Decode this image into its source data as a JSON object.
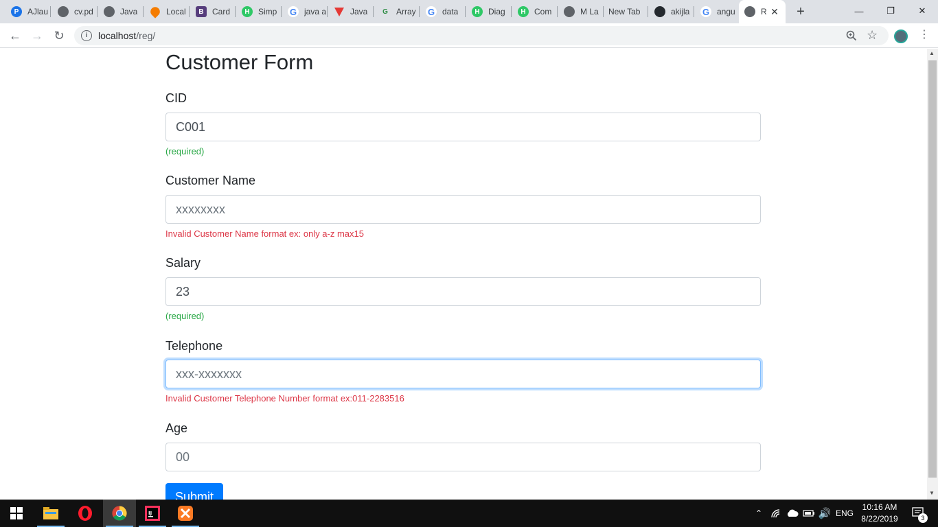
{
  "browser": {
    "tabs": [
      {
        "title": "AJlau",
        "icon": "chat-bubble-icon",
        "color": "#1a73e8"
      },
      {
        "title": "cv.pd",
        "icon": "globe-icon",
        "color": "#5f6368"
      },
      {
        "title": "Java",
        "icon": "globe-icon",
        "color": "#5f6368"
      },
      {
        "title": "Local",
        "icon": "map-pin-icon",
        "color": "#f57c00"
      },
      {
        "title": "Card",
        "icon": "bootstrap-icon",
        "color": "#563d7c"
      },
      {
        "title": "Simp",
        "icon": "hackerrank-icon",
        "color": "#2ec866"
      },
      {
        "title": "java a",
        "icon": "google-icon",
        "color": "#4285f4"
      },
      {
        "title": "Java",
        "icon": "vue-like-icon",
        "color": "#e53935"
      },
      {
        "title": "Array",
        "icon": "geeksforgeeks-icon",
        "color": "#2f8d46"
      },
      {
        "title": "data",
        "icon": "google-icon",
        "color": "#4285f4"
      },
      {
        "title": "Diag",
        "icon": "hackerrank-icon",
        "color": "#2ec866"
      },
      {
        "title": "Com",
        "icon": "hackerrank-icon",
        "color": "#2ec866"
      },
      {
        "title": "M La",
        "icon": "globe-icon",
        "color": "#5f6368"
      },
      {
        "title": "New Tab",
        "icon": "",
        "color": ""
      },
      {
        "title": "akijla",
        "icon": "github-icon",
        "color": "#24292e"
      },
      {
        "title": "angu",
        "icon": "google-icon",
        "color": "#4285f4"
      },
      {
        "title": "R",
        "icon": "globe-icon",
        "color": "#5f6368"
      }
    ],
    "url_host": "localhost",
    "url_path": "/reg/"
  },
  "form": {
    "title": "Customer Form",
    "cid": {
      "label": "CID",
      "value": "C001",
      "hint": "(required)"
    },
    "name": {
      "label": "Customer Name",
      "placeholder": "xxxxxxxx",
      "error": "Invalid Customer Name format ex: only a-z max15"
    },
    "salary": {
      "label": "Salary",
      "value": "23",
      "hint": "(required)"
    },
    "telephone": {
      "label": "Telephone",
      "placeholder": "xxx-xxxxxxx",
      "error": "Invalid Customer Telephone Number format ex:011-2283516"
    },
    "age": {
      "label": "Age",
      "placeholder": "00"
    },
    "submit_label": "Submit"
  },
  "taskbar": {
    "language": "ENG",
    "time": "10:16 AM",
    "date": "8/22/2019",
    "notification_count": "3"
  }
}
